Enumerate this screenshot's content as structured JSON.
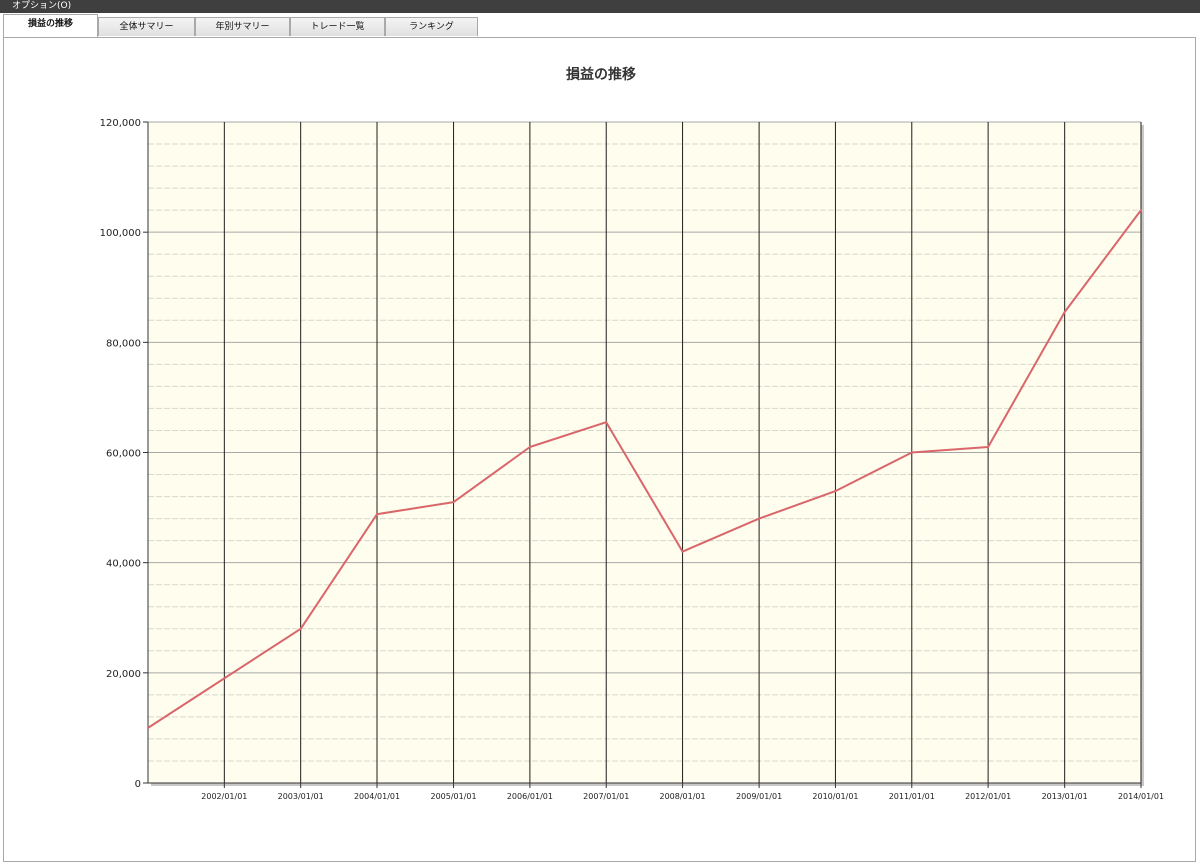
{
  "menu": {
    "options_label": "オプション(O)"
  },
  "tabs": [
    {
      "label": "損益の推移",
      "active": true
    },
    {
      "label": "全体サマリー",
      "active": false
    },
    {
      "label": "年別サマリー",
      "active": false
    },
    {
      "label": "トレード一覧",
      "active": false
    },
    {
      "label": "ランキング",
      "active": false
    }
  ],
  "colors": {
    "plot_background": "#fefdee",
    "line": "#d9666a",
    "major_grid": "#a8a8a8",
    "minor_grid": "#d8d8cc",
    "vertical_grid": "#1e1e1e"
  },
  "chart_data": {
    "type": "line",
    "title": "損益の推移",
    "xlabel": "",
    "ylabel": "",
    "ylim": [
      0,
      120000
    ],
    "yticks": [
      "0",
      "20,000",
      "40,000",
      "60,000",
      "80,000",
      "100,000",
      "120,000"
    ],
    "xlim": [
      "2001/01/01",
      "2014/01/01"
    ],
    "xticks": [
      "2002/01/01",
      "2003/01/01",
      "2004/01/01",
      "2005/01/01",
      "2006/01/01",
      "2007/01/01",
      "2008/01/01",
      "2009/01/01",
      "2010/01/01",
      "2011/01/01",
      "2012/01/01",
      "2013/01/01",
      "2014/01/01"
    ],
    "grid": true,
    "legend": "none",
    "series": [
      {
        "x": [
          "2001/01/01",
          "2003/01/01",
          "2004/01/01",
          "2005/01/01",
          "2006/01/01",
          "2007/01/01",
          "2008/01/01",
          "2009/01/01",
          "2010/01/01",
          "2011/01/01",
          "2012/01/01",
          "2013/01/01",
          "2014/01/01"
        ],
        "values": [
          10000,
          28000,
          48800,
          51000,
          61000,
          65500,
          42000,
          48000,
          53000,
          60000,
          61000,
          85500,
          104000
        ]
      }
    ]
  }
}
